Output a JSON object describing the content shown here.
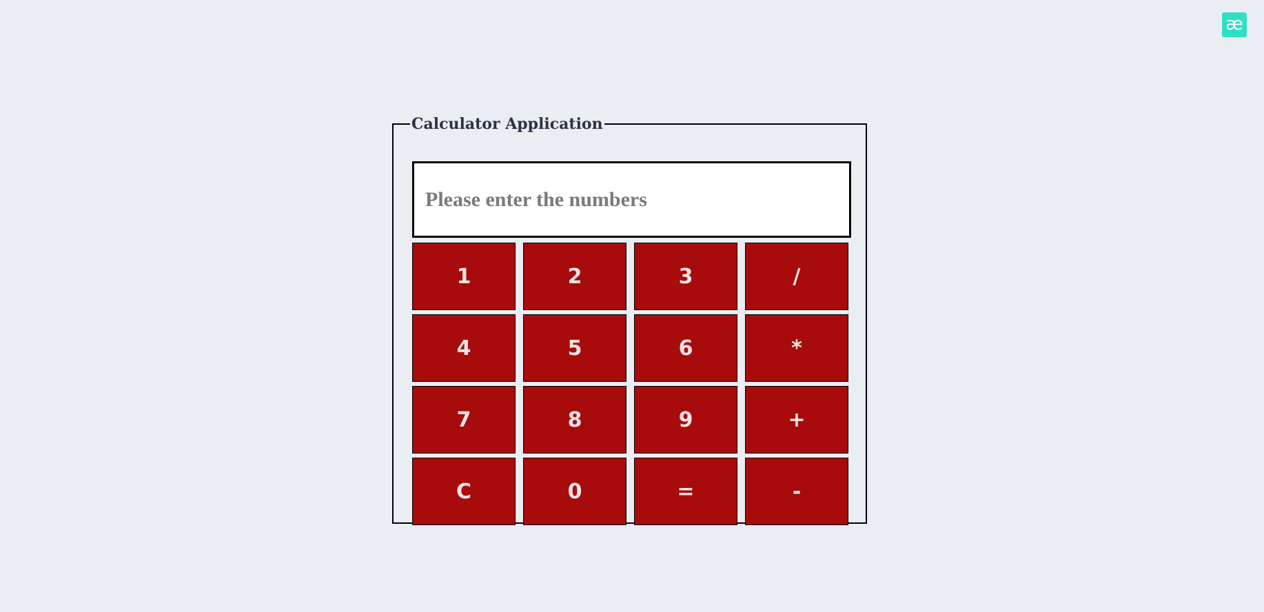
{
  "app": {
    "logo_text": "æ",
    "logo_color": "#2ee0c4"
  },
  "calculator": {
    "title": "Calculator Application",
    "display": {
      "value": "",
      "placeholder": "Please enter the numbers"
    },
    "key_color": "#a70b0b",
    "keys": [
      "1",
      "2",
      "3",
      "/",
      "4",
      "5",
      "6",
      "*",
      "7",
      "8",
      "9",
      "+",
      "C",
      "0",
      "=",
      "-"
    ]
  }
}
